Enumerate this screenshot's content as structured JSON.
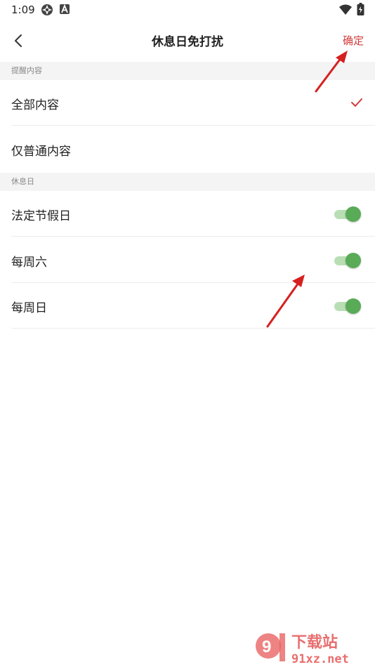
{
  "status_bar": {
    "time": "1:09",
    "icons": [
      "gear-icon",
      "a-icon",
      "wifi-icon",
      "battery-icon"
    ]
  },
  "header": {
    "title": "休息日免打扰",
    "confirm_label": "确定",
    "back_icon": "chevron-left-icon"
  },
  "sections": {
    "reminder": {
      "label": "提醒内容",
      "options": [
        {
          "label": "全部内容",
          "selected": true
        },
        {
          "label": "仅普通内容",
          "selected": false
        }
      ]
    },
    "rest_days": {
      "label": "休息日",
      "items": [
        {
          "label": "法定节假日",
          "enabled": true
        },
        {
          "label": "每周六",
          "enabled": true
        },
        {
          "label": "每周日",
          "enabled": true
        }
      ]
    }
  },
  "colors": {
    "accent": "#d23b3b",
    "toggle_on": "#5aab57",
    "toggle_track": "#b9deb4",
    "section_bg": "#f4f4f4"
  },
  "watermark": {
    "logo_text": "下载站",
    "domain": "91xz.net"
  }
}
